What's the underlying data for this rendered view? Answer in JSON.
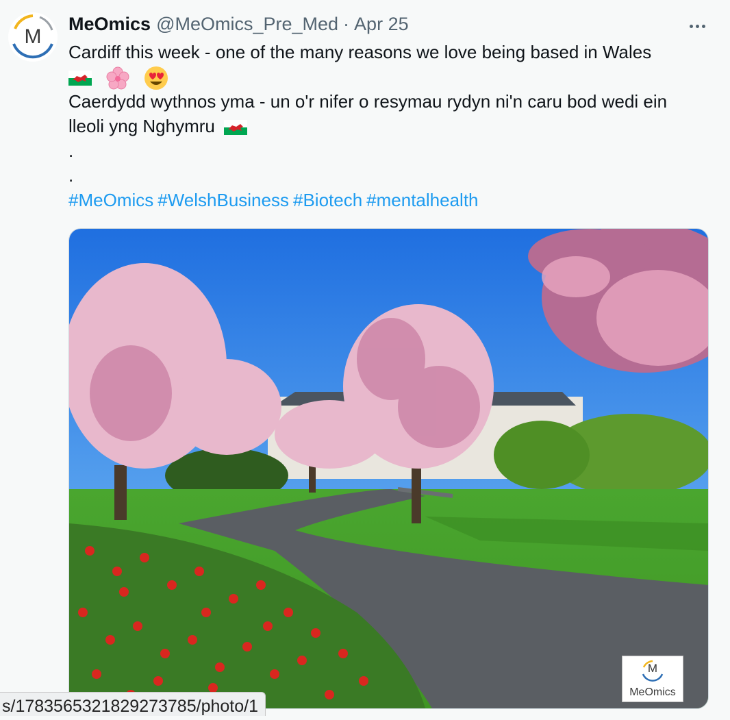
{
  "tweet": {
    "avatar_letter": "M",
    "display_name": "MeOmics",
    "handle": "@MeOmics_Pre_Med",
    "separator": "·",
    "date": "Apr 25",
    "lines": [
      "Cardiff this week - one of the many reasons we love being based in Wales",
      "Caerdydd wythnos yma - un o'r nifer o resymau rydyn ni'n caru bod wedi ein",
      "lleoli yng Nghymru",
      ".",
      "."
    ],
    "emojis": [
      "flag-wales-icon",
      "cherry-blossom-icon",
      "heart-eyes-icon"
    ],
    "hashtags": [
      "#MeOmics",
      "#WelshBusiness",
      "#Biotech",
      "#mentalhealth"
    ],
    "photo_badge": {
      "letter": "M",
      "text": "MeOmics"
    }
  },
  "status_bar": {
    "url": "s/1783565321829273785/photo/1"
  },
  "colors": {
    "link": "#1d9bf0",
    "muted": "#536471",
    "text": "#0f1419",
    "background": "#f7f9f9"
  }
}
